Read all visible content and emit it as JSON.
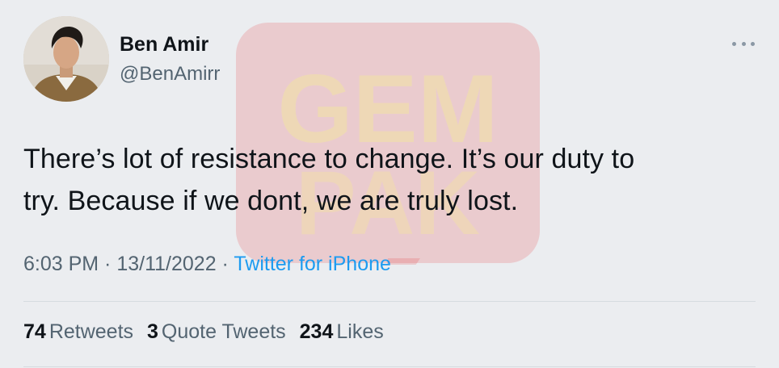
{
  "author": {
    "name": "Ben Amir",
    "handle": "@BenAmirr"
  },
  "tweet": {
    "text_line1": "There’s lot of resistance to change. It’s our duty to",
    "text_line2": "try. Because if we dont, we are truly lost."
  },
  "meta": {
    "time": "6:03 PM",
    "separator1": " · ",
    "date": "13/11/2022",
    "separator2": " · ",
    "source": "Twitter for iPhone"
  },
  "stats": [
    {
      "count": "74",
      "label": "Retweets"
    },
    {
      "count": "3",
      "label": "Quote Tweets"
    },
    {
      "count": "234",
      "label": "Likes"
    }
  ],
  "watermark": {
    "line1": "GEM",
    "line2": "PAK",
    "color": "#e8333a"
  },
  "icons": {
    "more": "more-horizontal-icon"
  },
  "colors": {
    "background": "#ebedf0",
    "text": "#0f1419",
    "secondary": "#536471",
    "accent": "#1d9bf0"
  }
}
